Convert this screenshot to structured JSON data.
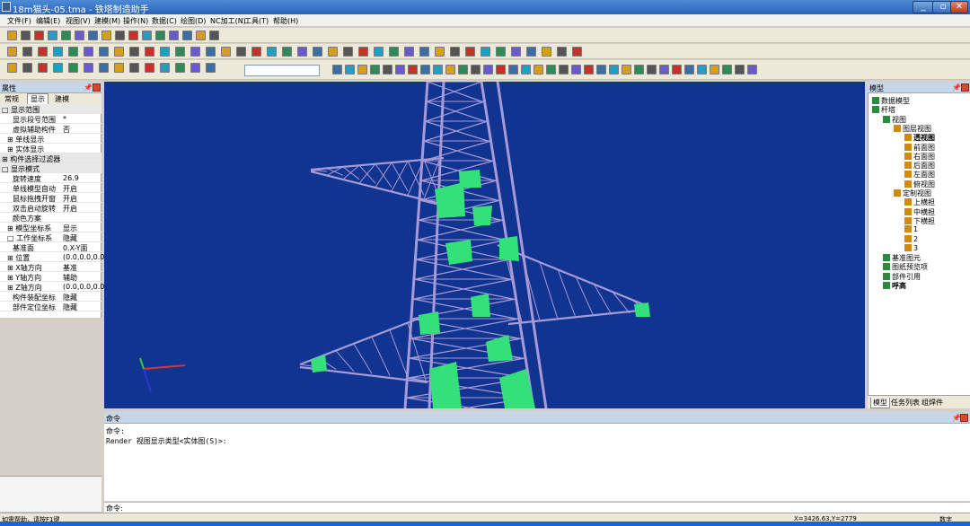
{
  "window": {
    "title": "18m猫头-05.tma - 铁塔制造助手"
  },
  "menu": [
    "文件(F)",
    "编辑(E)",
    "视图(V)",
    "建模(M)",
    "操作(N)",
    "数据(C)",
    "绘图(D)",
    "NC加工(N)",
    "工具(T)",
    "帮助(H)"
  ],
  "left_panel": {
    "title": "属性",
    "tabs": [
      "常规",
      "显示",
      "建模"
    ],
    "active_tab": "显示",
    "rows": [
      {
        "key": "□ 显示范围",
        "value": "",
        "category": true
      },
      {
        "key": "显示段号范围",
        "value": "*"
      },
      {
        "key": "虚拟辅助构件",
        "value": "否"
      },
      {
        "key": "⊞ 单线显示",
        "value": ""
      },
      {
        "key": "⊞ 实体显示",
        "value": ""
      },
      {
        "key": "⊞ 构件选择过滤器",
        "value": "",
        "category": true
      },
      {
        "key": "□ 显示模式",
        "value": "",
        "category": true
      },
      {
        "key": "旋转速度",
        "value": "26.9"
      },
      {
        "key": "单线模型自动",
        "value": "开启"
      },
      {
        "key": "鼠标拖拽开窗",
        "value": "开启"
      },
      {
        "key": "双击启动旋转",
        "value": "开启"
      },
      {
        "key": "颜色方案",
        "value": ""
      },
      {
        "key": "⊞ 模型坐标系",
        "value": "显示"
      },
      {
        "key": "□ 工作坐标系",
        "value": "隐藏"
      },
      {
        "key": "基准面",
        "value": "0.X-Y面"
      },
      {
        "key": "⊞ 位置",
        "value": "(0.0,0.0,0.0)"
      },
      {
        "key": "⊞ X轴方向",
        "value": "基准"
      },
      {
        "key": "⊞ Y轴方向",
        "value": "辅助"
      },
      {
        "key": "⊞ Z轴方向",
        "value": "(0.0,0.0,0.0)"
      },
      {
        "key": "构件装配坐标",
        "value": "隐藏"
      },
      {
        "key": "部件定位坐标",
        "value": "隐藏"
      }
    ]
  },
  "right_panel": {
    "title": "模型",
    "tree": [
      {
        "label": "数据模型",
        "depth": 0,
        "bold": false
      },
      {
        "label": "杆塔",
        "depth": 0,
        "bold": false
      },
      {
        "label": "视图",
        "depth": 1,
        "bold": false
      },
      {
        "label": "图层视图",
        "depth": 2,
        "bold": false
      },
      {
        "label": "透视图",
        "depth": 3,
        "bold": true
      },
      {
        "label": "前面图",
        "depth": 3,
        "bold": false
      },
      {
        "label": "右面图",
        "depth": 3,
        "bold": false
      },
      {
        "label": "后面图",
        "depth": 3,
        "bold": false
      },
      {
        "label": "左面图",
        "depth": 3,
        "bold": false
      },
      {
        "label": "俯视图",
        "depth": 3,
        "bold": false
      },
      {
        "label": "定制视图",
        "depth": 2,
        "bold": false
      },
      {
        "label": "上横担",
        "depth": 3,
        "bold": false
      },
      {
        "label": "中横担",
        "depth": 3,
        "bold": false
      },
      {
        "label": "下横担",
        "depth": 3,
        "bold": false
      },
      {
        "label": "1",
        "depth": 3,
        "bold": false
      },
      {
        "label": "2",
        "depth": 3,
        "bold": false
      },
      {
        "label": "3",
        "depth": 3,
        "bold": false
      },
      {
        "label": "基准图元",
        "depth": 1,
        "bold": false
      },
      {
        "label": "图纸预览项",
        "depth": 1,
        "bold": false
      },
      {
        "label": "部件引用",
        "depth": 1,
        "bold": false
      },
      {
        "label": "呼高",
        "depth": 1,
        "bold": true
      }
    ],
    "tabs": [
      "模型",
      "任务列表",
      "组焊件"
    ]
  },
  "command": {
    "title": "命令",
    "lines": [
      "命令:",
      "Render 视图显示类型<实体图(S)>:"
    ],
    "prompt": "命令:"
  },
  "status": {
    "left": "如需帮助，请按F1键",
    "coords": "X=3426.63,Y=2779",
    "mode": "数字"
  },
  "colors": {
    "viewport_bg": "#10348f",
    "steel": "#a79ad8",
    "plate": "#33e07a",
    "titlebar": "#2a62b8"
  }
}
